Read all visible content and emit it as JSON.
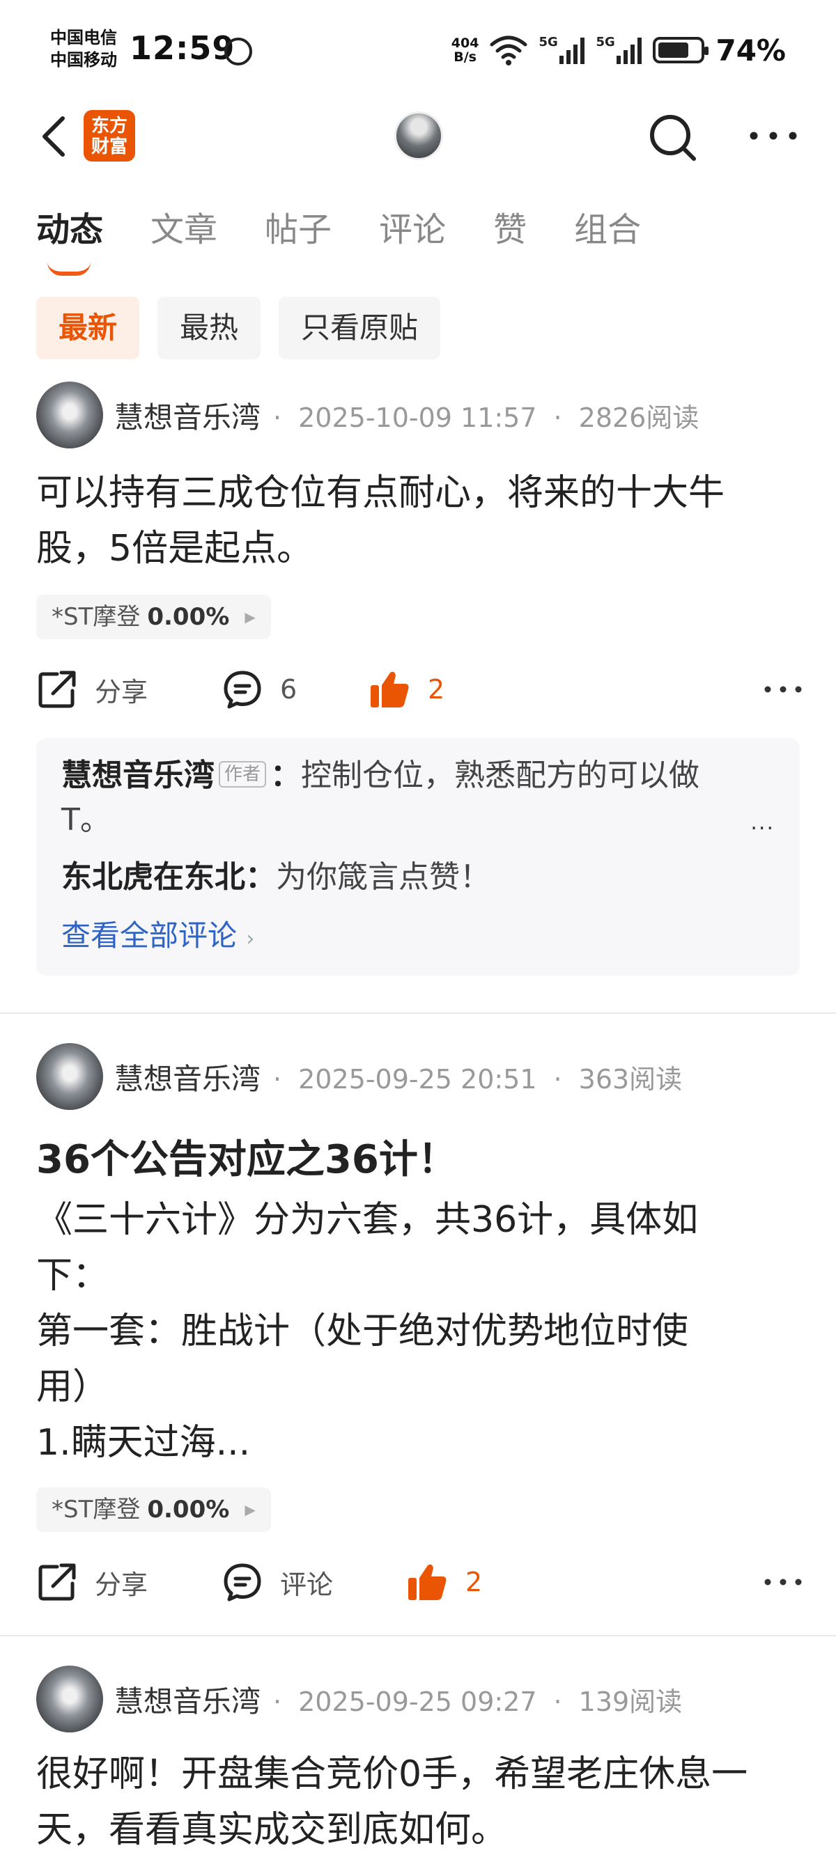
{
  "status_bar": {
    "carrier_line1": "中国电信",
    "carrier_line2": "中国移动",
    "time": "12:59",
    "net_speed_value": "404",
    "net_speed_unit": "B/s",
    "sim1_label": "5G",
    "sim2_label": "5G",
    "battery": "74%",
    "battery_level": 0.74
  },
  "header": {
    "logo_line1": "东方",
    "logo_line2": "财富",
    "back_icon": "chevron-left-icon",
    "search_icon": "search-icon",
    "more_icon": "more-horizontal-icon"
  },
  "tabs": [
    {
      "label": "动态",
      "active": true
    },
    {
      "label": "文章"
    },
    {
      "label": "帖子"
    },
    {
      "label": "评论"
    },
    {
      "label": "赞"
    },
    {
      "label": "组合"
    }
  ],
  "filters": [
    {
      "label": "最新",
      "active": true
    },
    {
      "label": "最热"
    },
    {
      "label": "只看原贴"
    }
  ],
  "posts": [
    {
      "author": "慧想音乐湾",
      "date": "2025-10-09 11:57",
      "reads": "2826阅读",
      "text_line1": "可以持有三成仓位有点耐心，将来的十大牛",
      "text_line2": "股，5倍是起点。",
      "stock_name": "*ST摩登",
      "stock_change": "0.00%",
      "share_label": "分享",
      "comment_label": "6",
      "like_count": "2",
      "comments": [
        {
          "user": "慧想音乐湾",
          "tag": "作者",
          "sep": "：",
          "text_line1": "控制仓位，熟悉配方的可以做",
          "text_line2": "T。",
          "more": "..."
        },
        {
          "user": "东北虎在东北",
          "sep": "：",
          "text": "为你箴言点赞！"
        }
      ],
      "view_all": "查看全部评论"
    },
    {
      "author": "慧想音乐湾",
      "date": "2025-09-25 20:51",
      "reads": "363阅读",
      "title": "36个公告对应之36计！",
      "text_line1": "《三十六计》分为六套，共36计，具体如",
      "text_line2": "下：",
      "text_line3": "第一套：胜战计（处于绝对优势地位时使",
      "text_line4": "用）",
      "text_line5": "1.瞒天过海...",
      "stock_name": "*ST摩登",
      "stock_change": "0.00%",
      "share_label": "分享",
      "comment_label": "评论",
      "like_count": "2"
    },
    {
      "author": "慧想音乐湾",
      "date": "2025-09-25 09:27",
      "reads": "139阅读",
      "text_line1": "很好啊！开盘集合竞价0手，希望老庄休息一",
      "text_line2": "天，看看真实成交到底如何。"
    }
  ],
  "colors": {
    "accent": "#ea5504",
    "link": "#2f64c4"
  }
}
